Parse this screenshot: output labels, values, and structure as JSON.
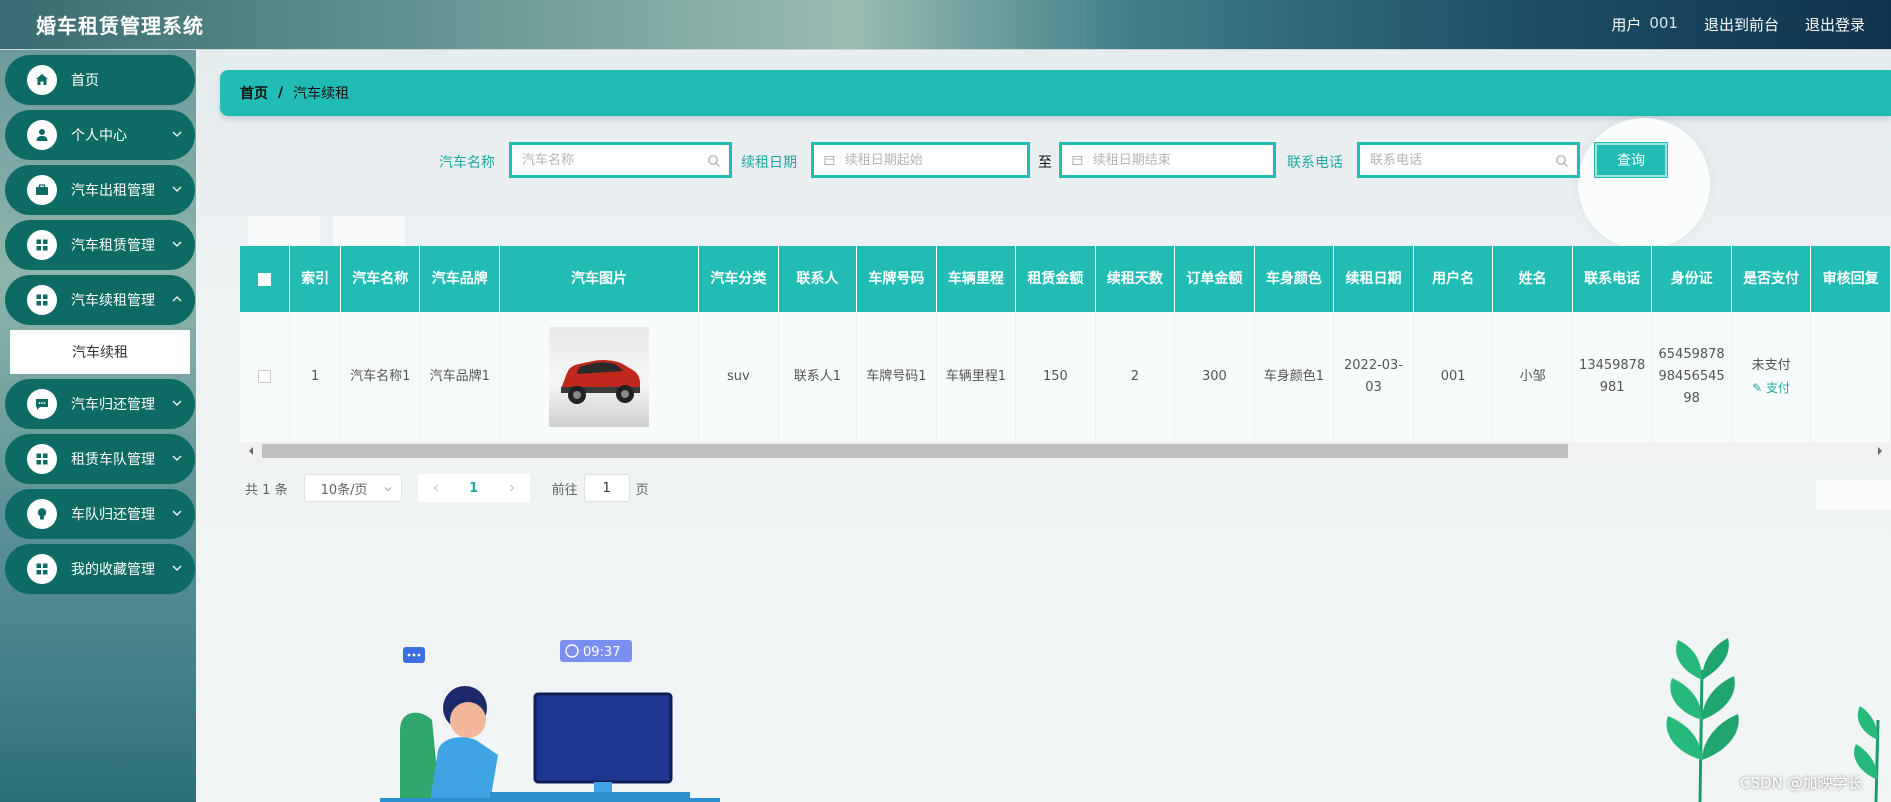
{
  "header": {
    "title": "婚车租赁管理系统",
    "user_label": "用户",
    "user_name": "001",
    "front_link": "退出到前台",
    "logout_link": "退出登录"
  },
  "sidebar": {
    "items": [
      {
        "label": "首页",
        "icon": "home-icon",
        "has_arrow": false
      },
      {
        "label": "个人中心",
        "icon": "user-icon",
        "has_arrow": true
      },
      {
        "label": "汽车出租管理",
        "icon": "briefcase-icon",
        "has_arrow": true
      },
      {
        "label": "汽车租赁管理",
        "icon": "grid-icon",
        "has_arrow": true
      },
      {
        "label": "汽车续租管理",
        "icon": "grid-icon",
        "has_arrow": true,
        "expanded": true
      },
      {
        "label": "汽车归还管理",
        "icon": "chat-icon",
        "has_arrow": true
      },
      {
        "label": "租赁车队管理",
        "icon": "grid-icon",
        "has_arrow": true
      },
      {
        "label": "车队归还管理",
        "icon": "bulb-icon",
        "has_arrow": true
      },
      {
        "label": "我的收藏管理",
        "icon": "grid-icon",
        "has_arrow": true
      }
    ],
    "sub_item": "汽车续租"
  },
  "breadcrumb": {
    "home": "首页",
    "separator": "/",
    "current": "汽车续租"
  },
  "search": {
    "car_name_label": "汽车名称",
    "car_name_placeholder": "汽车名称",
    "date_label": "续租日期",
    "date_start_placeholder": "续租日期起始",
    "date_to": "至",
    "date_end_placeholder": "续租日期结束",
    "phone_label": "联系电话",
    "phone_placeholder": "联系电话",
    "query_button": "查询"
  },
  "table": {
    "headers": [
      "索引",
      "汽车名称",
      "汽车品牌",
      "汽车图片",
      "汽车分类",
      "联系人",
      "车牌号码",
      "车辆里程",
      "租赁金额",
      "续租天数",
      "订单金额",
      "车身颜色",
      "续租日期",
      "用户名",
      "姓名",
      "联系电话",
      "身份证",
      "是否支付",
      "审核回复"
    ],
    "rows": [
      {
        "index": "1",
        "car_name": "汽车名称1",
        "brand": "汽车品牌1",
        "category": "suv",
        "contact": "联系人1",
        "plate": "车牌号码1",
        "mileage": "车辆里程1",
        "rent_amount": "150",
        "days": "2",
        "order_amount": "300",
        "color": "车身颜色1",
        "date": "2022-03-03",
        "username": "001",
        "name": "小邹",
        "phone": "13459878981",
        "id_card": "654598789845654598",
        "paid_status": "未支付",
        "pay_action": "支付",
        "review_reply": ""
      }
    ]
  },
  "pagination": {
    "total_prefix": "共",
    "total": "1",
    "total_suffix": "条",
    "page_size": "10条/页",
    "current_page": "1",
    "goto_prefix": "前往",
    "goto_value": "1",
    "goto_suffix": "页"
  },
  "illustration": {
    "clock_badge": "09:37"
  },
  "watermark": "CSDN @加映学长",
  "colors": {
    "accent": "#21bdb4",
    "sidebar_item": "#0d6b64"
  }
}
